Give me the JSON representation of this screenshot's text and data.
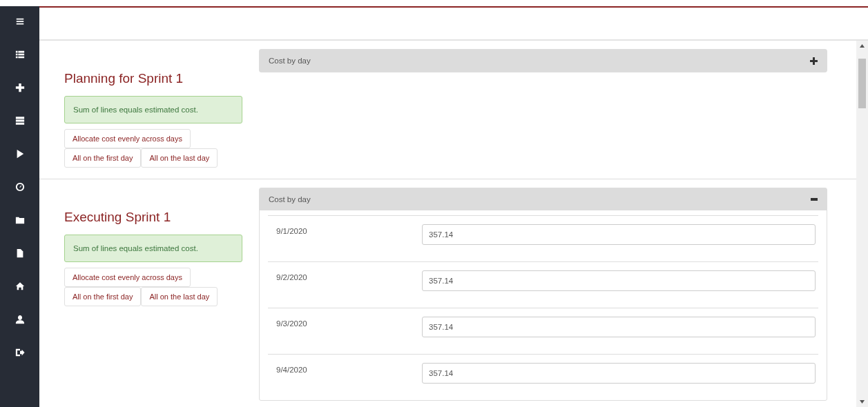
{
  "sections": [
    {
      "title": "Planning for Sprint 1",
      "alert": "Sum of lines equals estimated cost.",
      "buttons": [
        "Allocate cost evenly across days",
        "All on the first day",
        "All on the last day"
      ],
      "panel": {
        "header": "Cost by day",
        "expanded": false
      }
    },
    {
      "title": "Executing Sprint 1",
      "alert": "Sum of lines equals estimated cost.",
      "buttons": [
        "Allocate cost evenly across days",
        "All on the first day",
        "All on the last day"
      ],
      "panel": {
        "header": "Cost by day",
        "expanded": true,
        "rows": [
          {
            "date": "9/1/2020",
            "value": "357.14"
          },
          {
            "date": "9/2/2020",
            "value": "357.14"
          },
          {
            "date": "9/3/2020",
            "value": "357.14"
          },
          {
            "date": "9/4/2020",
            "value": "357.14"
          }
        ]
      }
    }
  ]
}
